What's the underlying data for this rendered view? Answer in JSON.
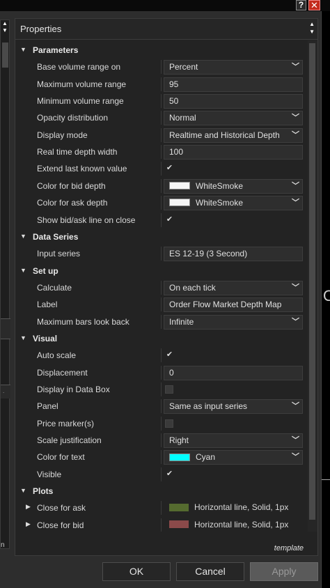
{
  "window": {
    "help_label": "?",
    "close_label": "✕",
    "right_glyph": "O"
  },
  "left_pane": {
    "fragment": "n"
  },
  "properties": {
    "title": "Properties",
    "rows": [
      {
        "type": "category",
        "label": "Parameters"
      },
      {
        "type": "dropdown",
        "label": "Base volume range on",
        "value": "Percent"
      },
      {
        "type": "text",
        "label": "Maximum volume range",
        "value": "95"
      },
      {
        "type": "text",
        "label": "Minimum volume range",
        "value": "50"
      },
      {
        "type": "dropdown",
        "label": "Opacity distribution",
        "value": "Normal"
      },
      {
        "type": "dropdown",
        "label": "Display mode",
        "value": "Realtime and Historical Depth"
      },
      {
        "type": "text",
        "label": "Real time depth width",
        "value": "100"
      },
      {
        "type": "check",
        "label": "Extend last known value",
        "checked": true
      },
      {
        "type": "color",
        "label": "Color for bid depth",
        "value": "WhiteSmoke",
        "color": "#f5f5f5"
      },
      {
        "type": "color",
        "label": "Color for ask depth",
        "value": "WhiteSmoke",
        "color": "#f5f5f5"
      },
      {
        "type": "check",
        "label": "Show bid/ask line on close",
        "checked": true
      },
      {
        "type": "category",
        "label": "Data Series"
      },
      {
        "type": "text",
        "label": "Input series",
        "value": "ES 12-19 (3 Second)"
      },
      {
        "type": "category",
        "label": "Set up"
      },
      {
        "type": "dropdown",
        "label": "Calculate",
        "value": "On each tick"
      },
      {
        "type": "text",
        "label": "Label",
        "value": "Order Flow Market Depth Map"
      },
      {
        "type": "dropdown",
        "label": "Maximum bars look back",
        "value": "Infinite"
      },
      {
        "type": "category",
        "label": "Visual"
      },
      {
        "type": "check",
        "label": "Auto scale",
        "checked": true
      },
      {
        "type": "text",
        "label": "Displacement",
        "value": "0"
      },
      {
        "type": "check",
        "label": "Display in Data Box",
        "checked": false
      },
      {
        "type": "dropdown",
        "label": "Panel",
        "value": "Same as input series"
      },
      {
        "type": "check",
        "label": "Price marker(s)",
        "checked": false
      },
      {
        "type": "dropdown",
        "label": "Scale justification",
        "value": "Right"
      },
      {
        "type": "color",
        "label": "Color for text",
        "value": "Cyan",
        "color": "#00ffff"
      },
      {
        "type": "check",
        "label": "Visible",
        "checked": true
      },
      {
        "type": "category",
        "label": "Plots"
      },
      {
        "type": "plot",
        "label": "Close for ask",
        "value": "Horizontal line, Solid, 1px",
        "color": "#556b2f"
      },
      {
        "type": "plot",
        "label": "Close for bid",
        "value": "Horizontal line, Solid, 1px",
        "color": "#8b4a4a"
      }
    ],
    "template_link": "template"
  },
  "buttons": {
    "ok": "OK",
    "cancel": "Cancel",
    "apply": "Apply"
  }
}
